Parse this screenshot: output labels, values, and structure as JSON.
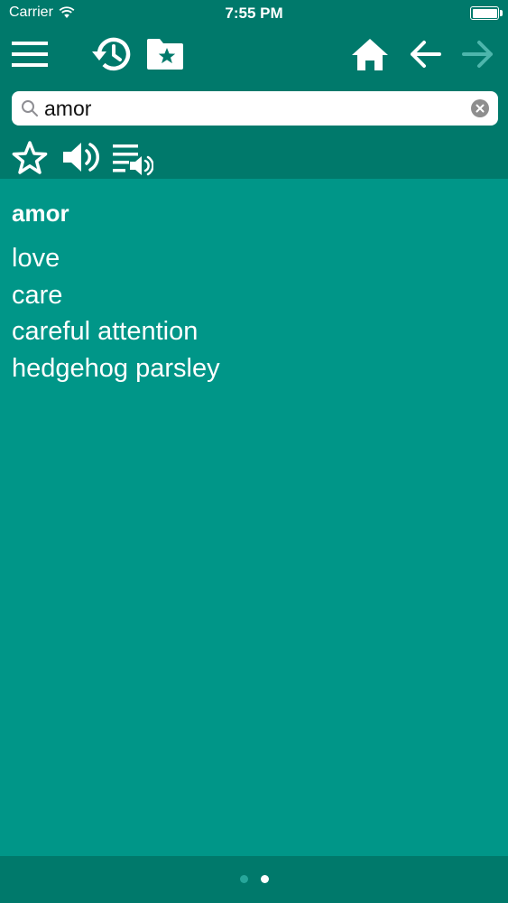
{
  "status_bar": {
    "carrier": "Carrier",
    "time": "7:55 PM"
  },
  "toolbar": {
    "icons": [
      "menu-icon",
      "history-icon",
      "favorites-folder-icon",
      "home-icon",
      "back-arrow-icon",
      "forward-arrow-icon",
      "star-icon",
      "speaker-icon",
      "playlist-audio-icon"
    ]
  },
  "search": {
    "value": "amor",
    "placeholder": ""
  },
  "entry": {
    "headword": "amor",
    "meanings": [
      "love",
      "care",
      "careful attention",
      "hedgehog parsley"
    ]
  },
  "pager": {
    "count": 2,
    "active": 2
  },
  "colors": {
    "background": "#009688",
    "bar": "#00796b",
    "text": "#ffffff",
    "disabled": "#4db6ac"
  }
}
